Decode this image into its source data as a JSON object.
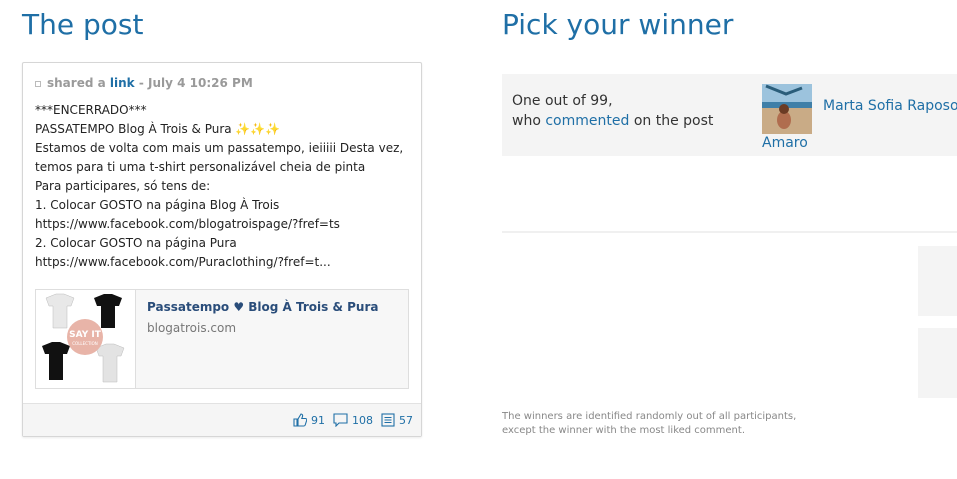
{
  "headings": {
    "post": "The post",
    "winner": "Pick your winner"
  },
  "post": {
    "meta_prefix": "shared a",
    "meta_link": "link",
    "meta_time": "- July 4 10:26 PM",
    "body_lines": [
      "***ENCERRADO***",
      "PASSATEMPO Blog À Trois & Pura ✨✨✨",
      "Estamos de volta com mais um passatempo, ieiiiii Desta vez,",
      "temos para ti uma t-shirt personalizável cheia de pinta",
      "Para participares, só tens de:",
      "1. Colocar GOSTO na página Blog À Trois",
      "https://www.facebook.com/blogatroispage/?fref=ts",
      "2. Colocar GOSTO na página Pura",
      "https://www.facebook.com/Puraclothing/?fref=t..."
    ],
    "preview": {
      "title": "Passatempo ♥ Blog À Trois & Pura",
      "domain": "blogatrois.com",
      "thumb_text": "SAY IT",
      "thumb_subtext": "COLLECTION"
    },
    "stats": {
      "likes": "91",
      "comments": "108",
      "shares": "57"
    }
  },
  "winner": {
    "line1": "One out of 99,",
    "line2_pre": "who",
    "line2_link": "commented",
    "line2_post": "on the post",
    "name_part1": "Marta Sofia Raposo",
    "name_part2": "Amaro"
  },
  "footnote": {
    "line1": "The winners are identified randomly out of all participants,",
    "line2": "except the winner with the most liked comment."
  },
  "colors": {
    "accent": "#1f6fa6",
    "panel": "#f4f4f4"
  }
}
